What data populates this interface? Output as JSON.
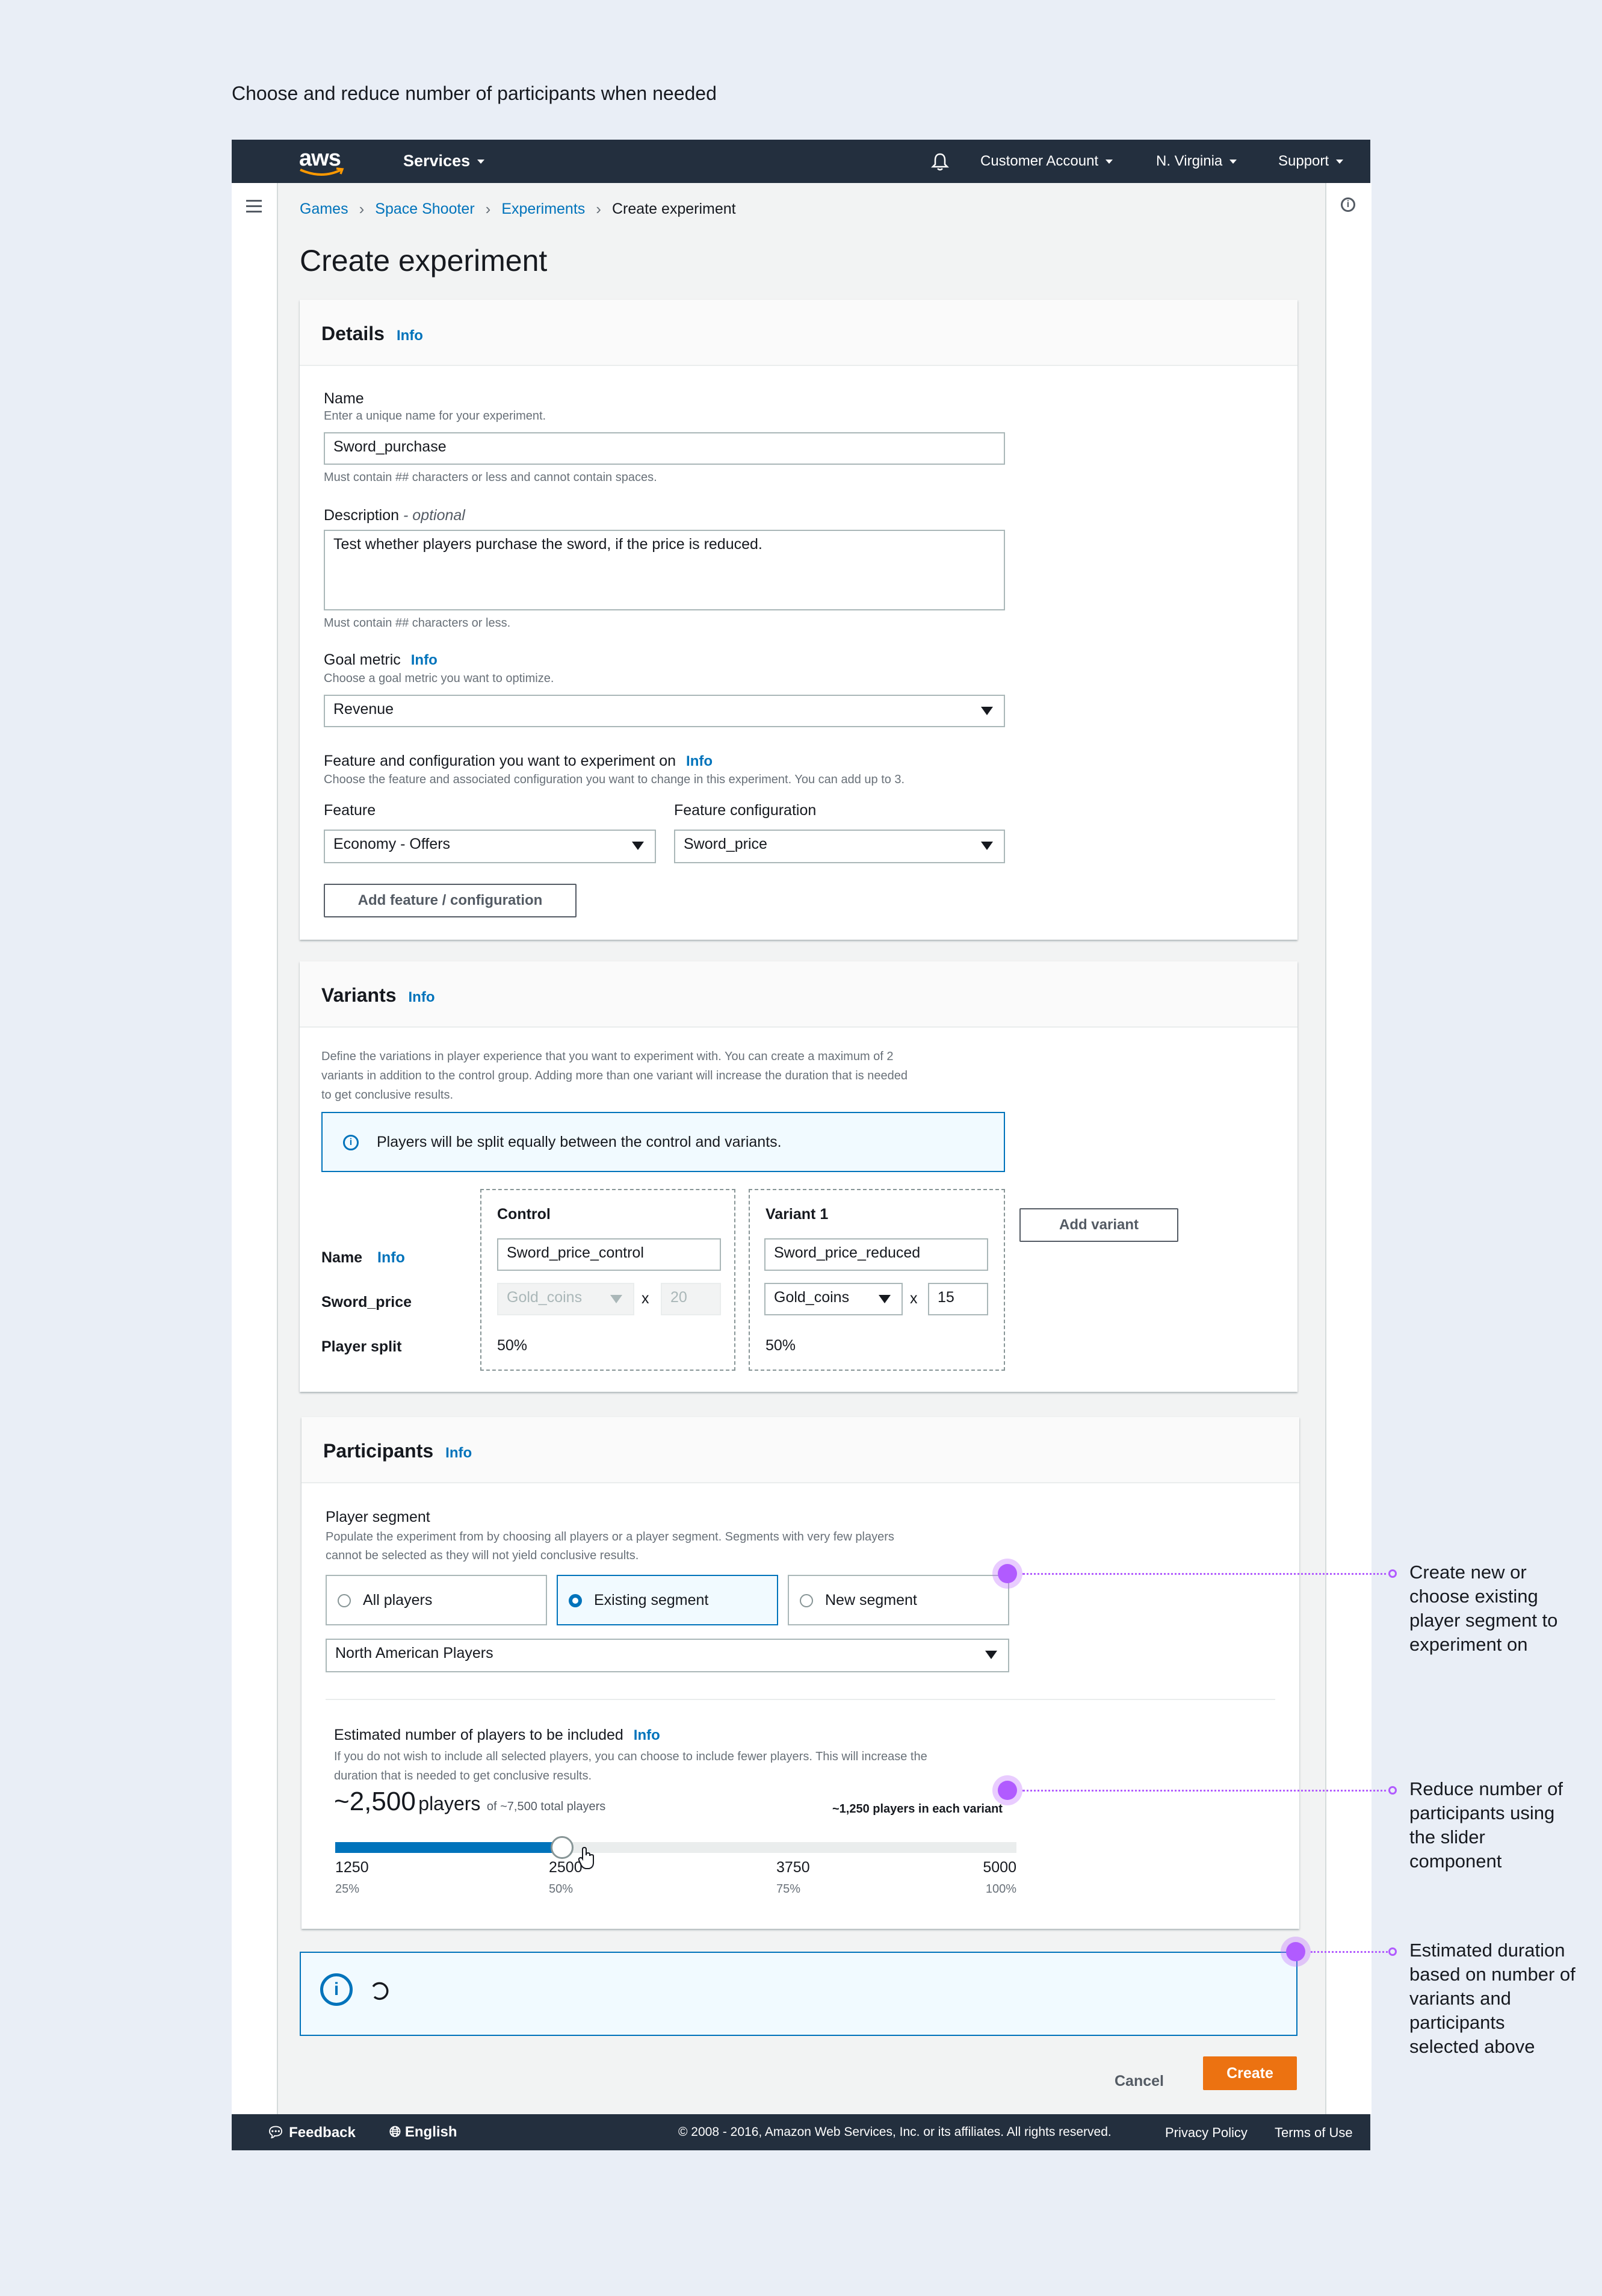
{
  "page_caption": "Choose and reduce number of participants when needed",
  "topnav": {
    "logo": "aws",
    "services": "Services",
    "account": "Customer Account",
    "region": "N. Virginia",
    "support": "Support"
  },
  "breadcrumbs": [
    "Games",
    "Space Shooter",
    "Experiments",
    "Create experiment"
  ],
  "page_title": "Create experiment",
  "details": {
    "title": "Details",
    "info": "Info",
    "name_label": "Name",
    "name_desc": "Enter a unique name for your experiment.",
    "name_value": "Sword_purchase",
    "name_constraint": "Must contain ## characters or less and cannot contain spaces.",
    "desc_label": "Description",
    "desc_optional": "- optional",
    "desc_value": "Test whether players purchase the sword, if the price is reduced.",
    "desc_constraint": "Must contain ## characters or less.",
    "goal_label": "Goal metric",
    "goal_info": "Info",
    "goal_desc": "Choose a goal metric you want to optimize.",
    "goal_value": "Revenue",
    "feature_section_label": "Feature and configuration you want to experiment on",
    "feature_section_info": "Info",
    "feature_section_desc": "Choose the feature and associated configuration you want to change in this experiment. You can add up to 3.",
    "feature_label": "Feature",
    "feature_value": "Economy - Offers",
    "config_label": "Feature configuration",
    "config_value": "Sword_price",
    "add_button": "Add feature / configuration"
  },
  "variants": {
    "title": "Variants",
    "info": "Info",
    "desc_line1": "Define the variations in player experience that you want to experiment with. You can create a maximum of 2",
    "desc_line2": "variants in addition to the control group. Adding more than one variant will increase the duration that is needed",
    "desc_line3": "to get conclusive results.",
    "alert": "Players will be split equally between the control and variants.",
    "row_name": "Name",
    "row_name_info": "Info",
    "row_price": "Sword_price",
    "row_split": "Player split",
    "control_title": "Control",
    "control_name": "Sword_price_control",
    "control_currency": "Gold_coins",
    "control_qty": "20",
    "control_split": "50%",
    "variant_title": "Variant 1",
    "variant_name": "Sword_price_reduced",
    "variant_currency": "Gold_coins",
    "variant_qty": "15",
    "variant_split": "50%",
    "times": "x",
    "add_variant": "Add variant"
  },
  "participants": {
    "title": "Participants",
    "info": "Info",
    "segment_label": "Player segment",
    "segment_desc1": "Populate the experiment from by choosing all players or a player segment. Segments with very few players",
    "segment_desc2": "cannot be selected as they will not yield conclusive results.",
    "options": [
      "All players",
      "Existing segment",
      "New segment"
    ],
    "selected_option": "Existing segment",
    "segment_value": "North American Players",
    "estimate_label": "Estimated number of players to be included",
    "estimate_info": "Info",
    "estimate_desc1": "If you do not wish to include all selected players, you can choose to include fewer players. This will increase the",
    "estimate_desc2": "duration that is needed to get conclusive results.",
    "players_count": "~2,500",
    "players_word": "players",
    "players_total": "of ~7,500 total players",
    "per_variant": "~1,250 players in each variant",
    "slider_value": 2500,
    "slider_min": 1250,
    "slider_max": 5000,
    "ticks": [
      {
        "value": "1250",
        "pct": "25%"
      },
      {
        "value": "2500",
        "pct": "50%"
      },
      {
        "value": "3750",
        "pct": "75%"
      },
      {
        "value": "5000",
        "pct": "100%"
      }
    ]
  },
  "actions": {
    "cancel": "Cancel",
    "create": "Create"
  },
  "footer": {
    "feedback": "Feedback",
    "language": "English",
    "copyright": "© 2008 - 2016, Amazon Web Services, Inc. or its affiliates. All rights reserved.",
    "privacy": "Privacy Policy",
    "terms": "Terms of Use"
  },
  "annotations": [
    "Create new or choose existing player segment to experiment on",
    "Reduce number of participants using the slider component",
    "Estimated duration based on number of variants and participants selected above"
  ],
  "colors": {
    "nav_bg": "#232f3e",
    "link": "#0073bb",
    "primary_button": "#ec7211",
    "annotation": "#b15bff",
    "page_bg": "#e9eef6"
  }
}
